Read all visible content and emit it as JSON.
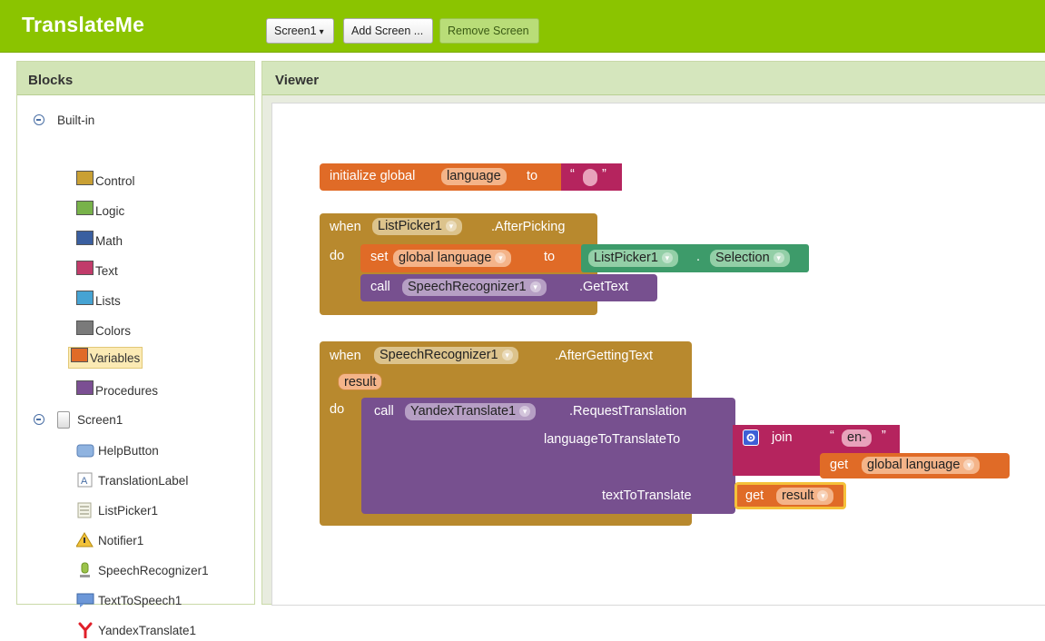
{
  "app": {
    "title": "TranslateMe"
  },
  "toolbar": {
    "screen_select": "Screen1",
    "add_screen": "Add Screen ...",
    "remove_screen": "Remove Screen"
  },
  "blocks_panel": {
    "header": "Blocks",
    "builtin": {
      "label": "Built-in",
      "items": [
        {
          "label": "Control",
          "color": "#c9a034"
        },
        {
          "label": "Logic",
          "color": "#78b24a"
        },
        {
          "label": "Math",
          "color": "#3a5fa0"
        },
        {
          "label": "Text",
          "color": "#c13b6a"
        },
        {
          "label": "Lists",
          "color": "#46a3d3"
        },
        {
          "label": "Colors",
          "color": "#7a7a7a"
        },
        {
          "label": "Variables",
          "color": "#e06b27"
        },
        {
          "label": "Procedures",
          "color": "#7b4f93"
        }
      ]
    },
    "screen": {
      "label": "Screen1",
      "components": [
        {
          "label": "HelpButton",
          "icon": "button-icon"
        },
        {
          "label": "TranslationLabel",
          "icon": "label-icon"
        },
        {
          "label": "ListPicker1",
          "icon": "listpicker-icon"
        },
        {
          "label": "Notifier1",
          "icon": "notifier-icon"
        },
        {
          "label": "SpeechRecognizer1",
          "icon": "microphone-icon"
        },
        {
          "label": "TextToSpeech1",
          "icon": "speech-icon"
        },
        {
          "label": "YandexTranslate1",
          "icon": "yandex-icon"
        }
      ]
    }
  },
  "viewer": {
    "header": "Viewer",
    "blocks": {
      "init": {
        "text1": "initialize global",
        "name": "language",
        "text2": "to",
        "string_quote_open": "“",
        "string_quote_close": "”"
      },
      "event1": {
        "when": "when",
        "component": "ListPicker1",
        "event": ".AfterPicking",
        "do": "do",
        "set": "set",
        "var": "global language",
        "to": "to",
        "getter_component": "ListPicker1",
        "dot": ".",
        "property": "Selection",
        "call": "call",
        "call_component": "SpeechRecognizer1",
        "method": ".GetText"
      },
      "event2": {
        "when": "when",
        "component": "SpeechRecognizer1",
        "event": ".AfterGettingText",
        "param": "result",
        "do": "do",
        "call": "call",
        "call_component": "YandexTranslate1",
        "method": ".RequestTranslation",
        "arg1": "languageToTranslateTo",
        "join": "join",
        "string_en": "en-",
        "quote_open": "“",
        "quote_close": "”",
        "get": "get",
        "get_var": "global language",
        "arg2": "textToTranslate",
        "get2": "get",
        "get_result": "result"
      }
    }
  }
}
